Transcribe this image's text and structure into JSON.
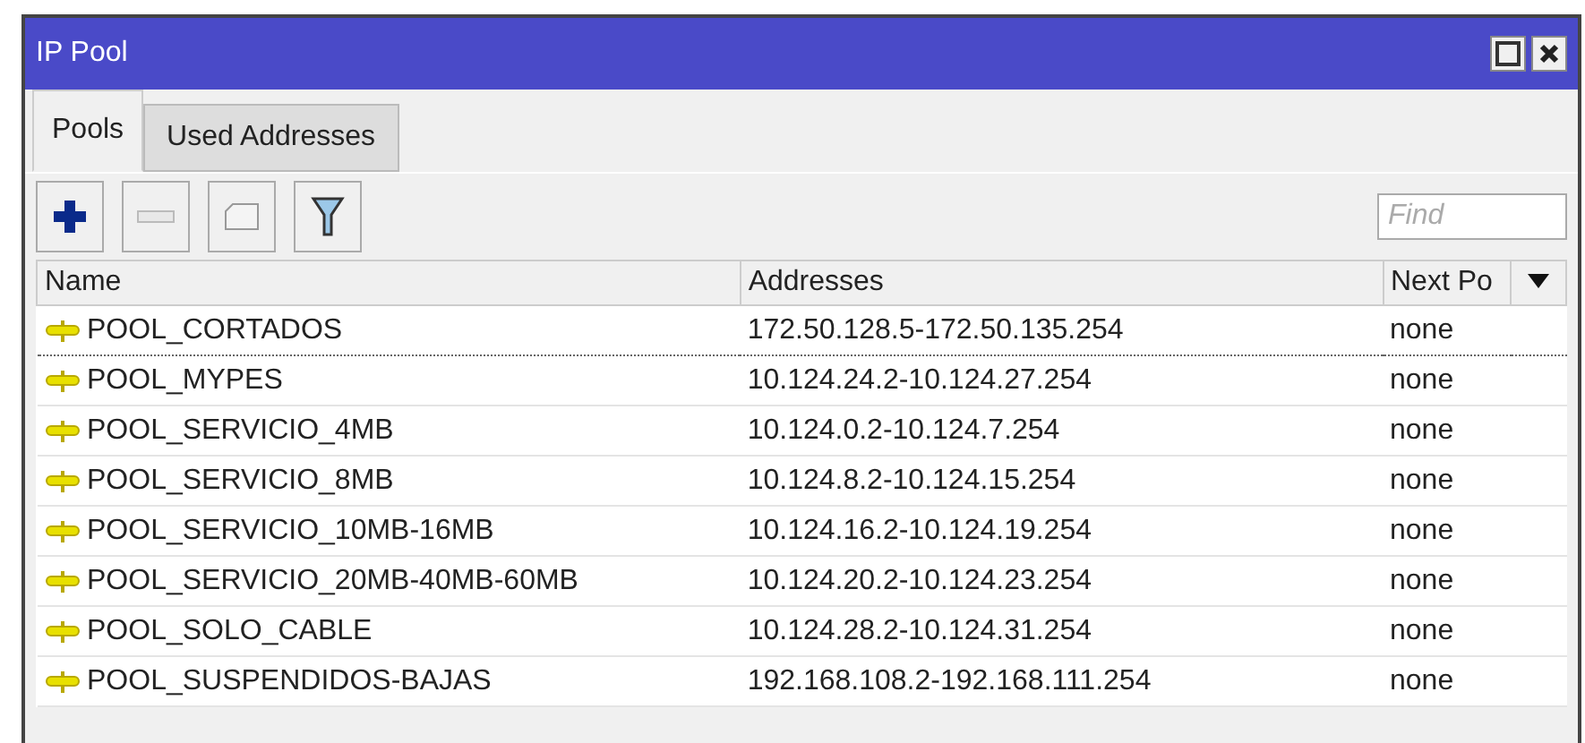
{
  "window": {
    "title": "IP Pool"
  },
  "tabs": [
    {
      "label": "Pools",
      "selected": true
    },
    {
      "label": "Used Addresses",
      "selected": false
    }
  ],
  "search": {
    "placeholder": "Find"
  },
  "table": {
    "columns": [
      "Name",
      "Addresses",
      "Next Po"
    ],
    "rows": [
      {
        "name": "POOL_CORTADOS",
        "addresses": "172.50.128.5-172.50.135.254",
        "next_pool": "none",
        "focused": true
      },
      {
        "name": "POOL_MYPES",
        "addresses": "10.124.24.2-10.124.27.254",
        "next_pool": "none",
        "focused": false
      },
      {
        "name": "POOL_SERVICIO_4MB",
        "addresses": "10.124.0.2-10.124.7.254",
        "next_pool": "none",
        "focused": false
      },
      {
        "name": "POOL_SERVICIO_8MB",
        "addresses": "10.124.8.2-10.124.15.254",
        "next_pool": "none",
        "focused": false
      },
      {
        "name": "POOL_SERVICIO_10MB-16MB",
        "addresses": "10.124.16.2-10.124.19.254",
        "next_pool": "none",
        "focused": false
      },
      {
        "name": "POOL_SERVICIO_20MB-40MB-60MB",
        "addresses": "10.124.20.2-10.124.23.254",
        "next_pool": "none",
        "focused": false
      },
      {
        "name": "POOL_SOLO_CABLE",
        "addresses": "10.124.28.2-10.124.31.254",
        "next_pool": "none",
        "focused": false
      },
      {
        "name": "POOL_SUSPENDIDOS-BAJAS",
        "addresses": "192.168.108.2-192.168.111.254",
        "next_pool": "none",
        "focused": false
      }
    ]
  }
}
